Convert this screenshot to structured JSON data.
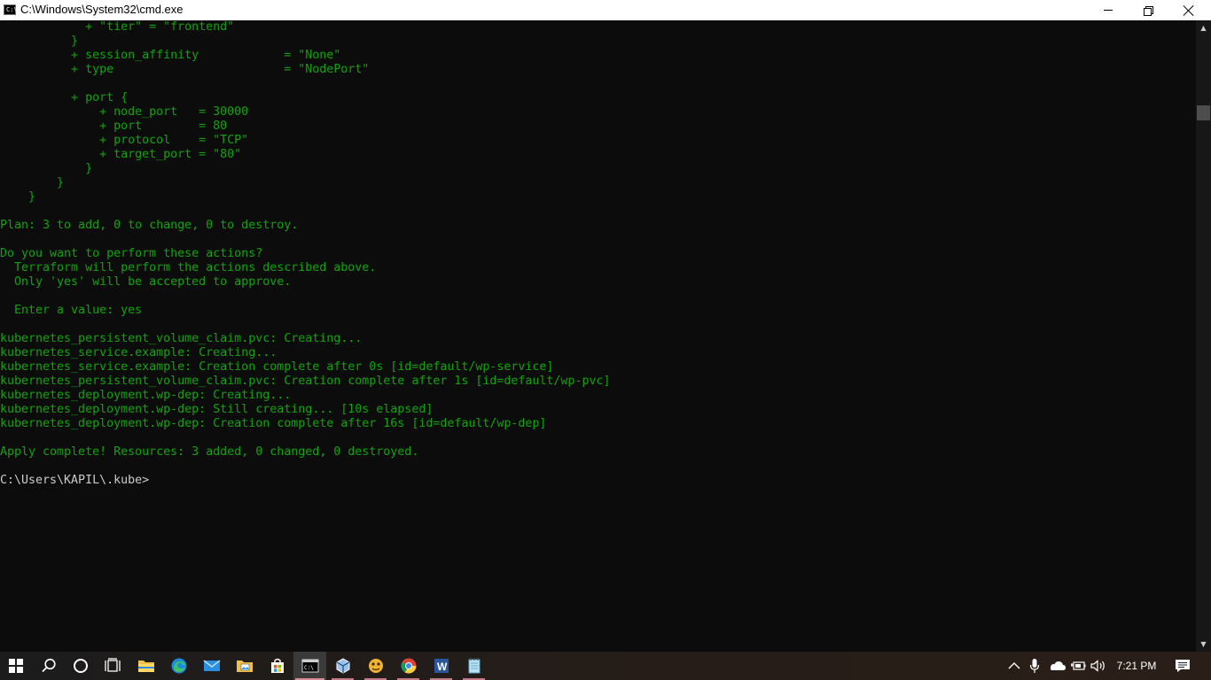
{
  "window": {
    "title": "C:\\Windows\\System32\\cmd.exe",
    "icon_text": "C:\\"
  },
  "console": {
    "lines": [
      {
        "text": "            + \"tier\" = \"frontend\"",
        "type": "output"
      },
      {
        "text": "          }",
        "type": "output"
      },
      {
        "text": "          + session_affinity            = \"None\"",
        "type": "output"
      },
      {
        "text": "          + type                        = \"NodePort\"",
        "type": "output"
      },
      {
        "text": "",
        "type": "output"
      },
      {
        "text": "          + port {",
        "type": "output"
      },
      {
        "text": "              + node_port   = 30000",
        "type": "output"
      },
      {
        "text": "              + port        = 80",
        "type": "output"
      },
      {
        "text": "              + protocol    = \"TCP\"",
        "type": "output"
      },
      {
        "text": "              + target_port = \"80\"",
        "type": "output"
      },
      {
        "text": "            }",
        "type": "output"
      },
      {
        "text": "        }",
        "type": "output"
      },
      {
        "text": "    }",
        "type": "output"
      },
      {
        "text": "",
        "type": "output"
      },
      {
        "text": "Plan: 3 to add, 0 to change, 0 to destroy.",
        "type": "output"
      },
      {
        "text": "",
        "type": "output"
      },
      {
        "text": "Do you want to perform these actions?",
        "type": "output"
      },
      {
        "text": "  Terraform will perform the actions described above.",
        "type": "output"
      },
      {
        "text": "  Only 'yes' will be accepted to approve.",
        "type": "output"
      },
      {
        "text": "",
        "type": "output"
      },
      {
        "text": "  Enter a value: yes",
        "type": "output"
      },
      {
        "text": "",
        "type": "output"
      },
      {
        "text": "kubernetes_persistent_volume_claim.pvc: Creating...",
        "type": "output"
      },
      {
        "text": "kubernetes_service.example: Creating...",
        "type": "output"
      },
      {
        "text": "kubernetes_service.example: Creation complete after 0s [id=default/wp-service]",
        "type": "output"
      },
      {
        "text": "kubernetes_persistent_volume_claim.pvc: Creation complete after 1s [id=default/wp-pvc]",
        "type": "output"
      },
      {
        "text": "kubernetes_deployment.wp-dep: Creating...",
        "type": "output"
      },
      {
        "text": "kubernetes_deployment.wp-dep: Still creating... [10s elapsed]",
        "type": "output"
      },
      {
        "text": "kubernetes_deployment.wp-dep: Creation complete after 16s [id=default/wp-dep]",
        "type": "output"
      },
      {
        "text": "",
        "type": "output"
      },
      {
        "text": "Apply complete! Resources: 3 added, 0 changed, 0 destroyed.",
        "type": "output"
      },
      {
        "text": "",
        "type": "output"
      },
      {
        "text": "C:\\Users\\KAPIL\\.kube>",
        "type": "prompt"
      }
    ]
  },
  "colors": {
    "terminal_background": "#0c0c0c",
    "terraform_output": "#13a10e",
    "prompt_text": "#cccccc",
    "taskbar_indicator": "#c47c87"
  },
  "taskbar": {
    "apps": [
      {
        "name": "start-button",
        "icon": "windows-logo-icon",
        "interactable": true
      },
      {
        "name": "search-button",
        "icon": "search-icon",
        "interactable": true
      },
      {
        "name": "cortana-button",
        "icon": "cortana-ring-icon",
        "interactable": true
      },
      {
        "name": "task-view-button",
        "icon": "task-view-icon",
        "interactable": true
      },
      {
        "name": "file-explorer-app",
        "icon": "folder-icon",
        "interactable": true
      },
      {
        "name": "edge-app",
        "icon": "edge-icon",
        "interactable": true
      },
      {
        "name": "mail-app",
        "icon": "mail-icon",
        "interactable": true
      },
      {
        "name": "photo-app",
        "icon": "photo-folder-icon",
        "interactable": true
      },
      {
        "name": "store-app",
        "icon": "store-bag-icon",
        "interactable": true
      },
      {
        "name": "cmd-app",
        "icon": "command-prompt-icon",
        "interactable": true,
        "active": true
      },
      {
        "name": "virtualbox-app",
        "icon": "cube-icon",
        "interactable": true,
        "running": true
      },
      {
        "name": "game-app",
        "icon": "character-icon",
        "interactable": true,
        "running": true
      },
      {
        "name": "chrome-app",
        "icon": "chrome-icon",
        "interactable": true,
        "running": true
      },
      {
        "name": "word-app",
        "icon": "word-icon",
        "interactable": true,
        "running": true
      },
      {
        "name": "notepad-app",
        "icon": "notepad-icon",
        "interactable": true,
        "running": true
      }
    ],
    "tray": {
      "time": "7:21 PM"
    }
  }
}
